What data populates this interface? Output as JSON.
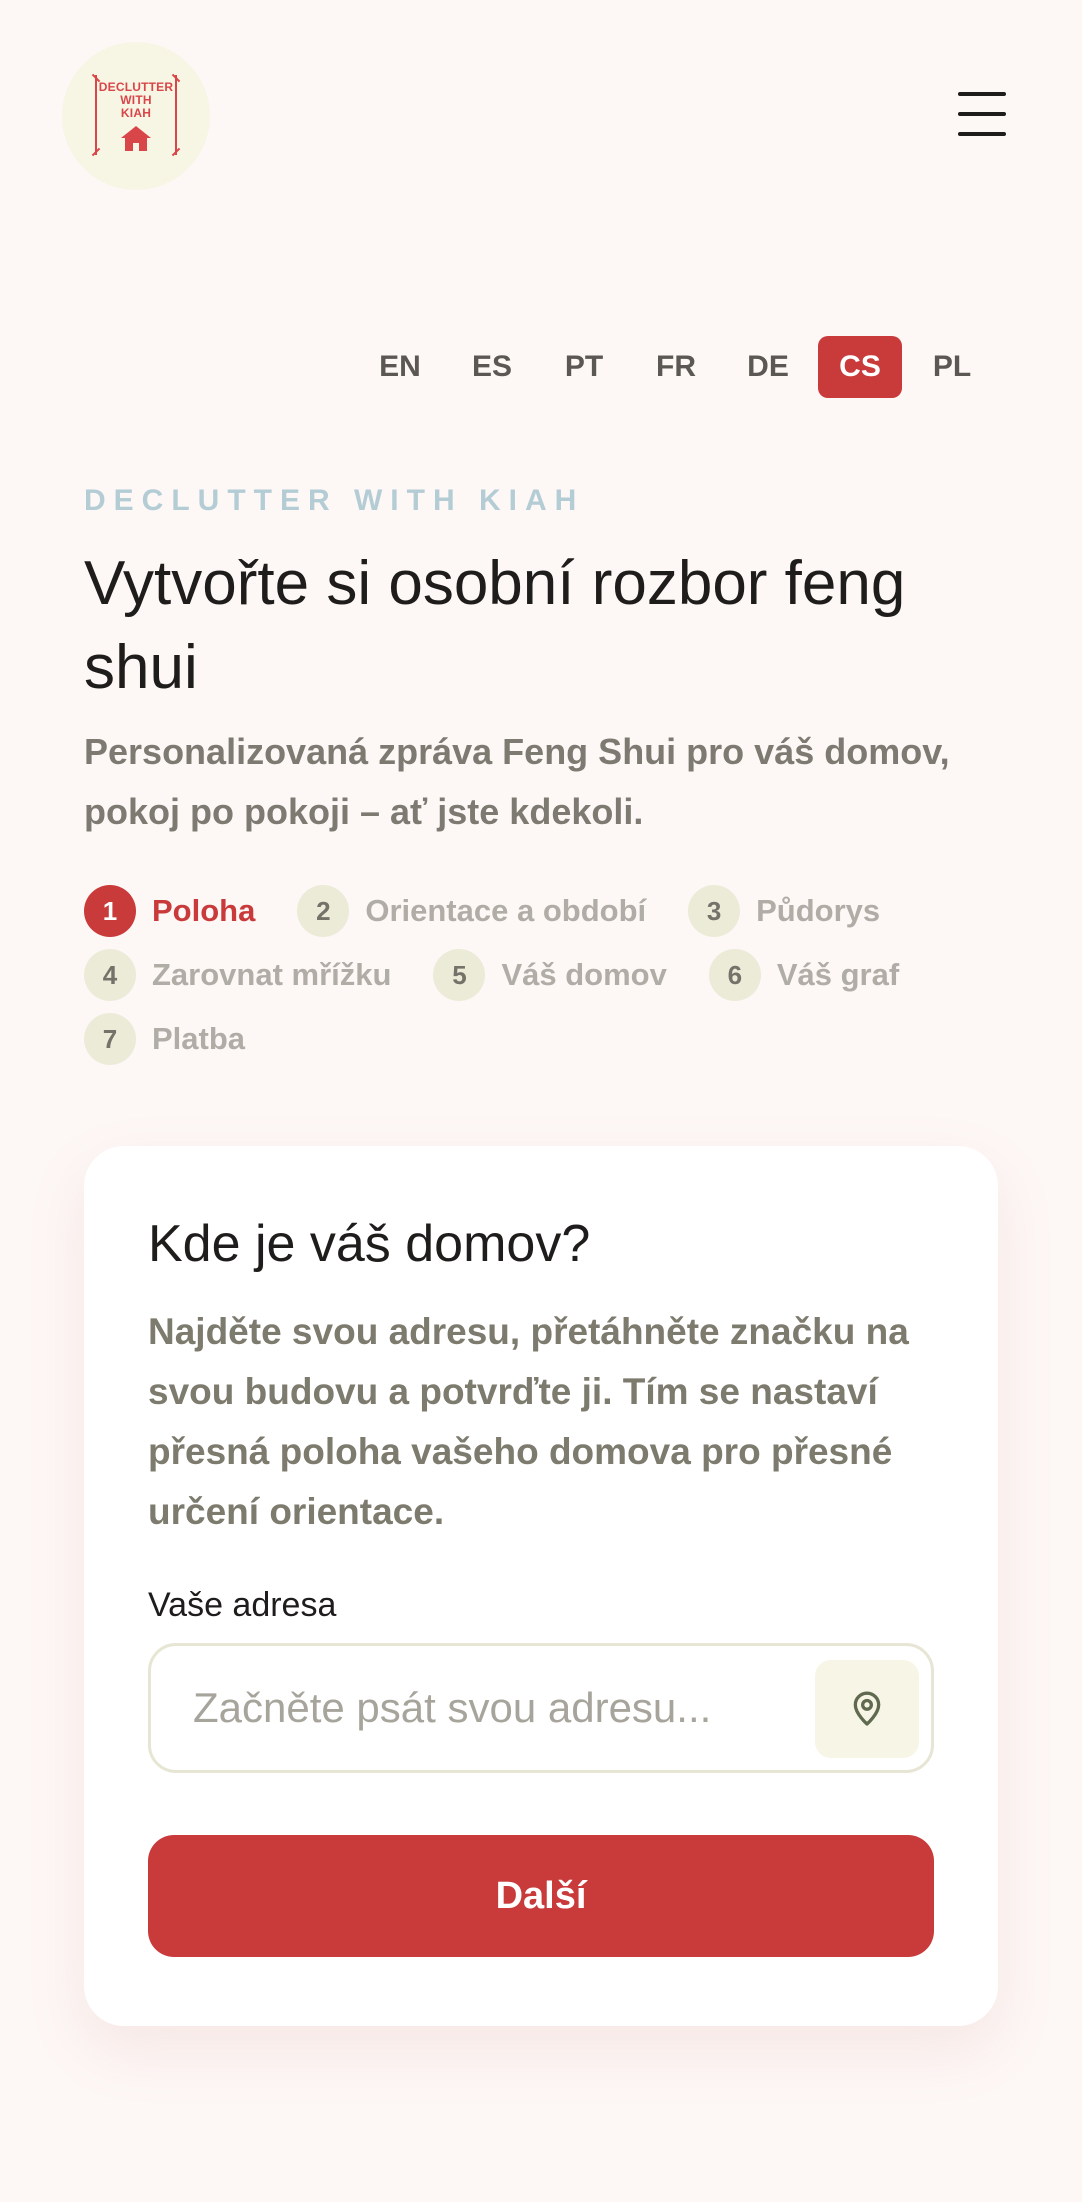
{
  "header": {
    "logo_lines": [
      "DECLUTTER",
      "WITH",
      "KIAH"
    ],
    "menu_icon": "hamburger-menu-icon"
  },
  "languages": [
    {
      "code": "EN",
      "active": false
    },
    {
      "code": "ES",
      "active": false
    },
    {
      "code": "PT",
      "active": false
    },
    {
      "code": "FR",
      "active": false
    },
    {
      "code": "DE",
      "active": false
    },
    {
      "code": "CS",
      "active": true
    },
    {
      "code": "PL",
      "active": false
    }
  ],
  "intro": {
    "eyebrow": "DECLUTTER WITH KIAH",
    "title": "Vytvořte si osobní rozbor feng shui",
    "subtitle": "Personalizovaná zpráva Feng Shui pro váš domov, pokoj po pokoji – ať jste kdekoli."
  },
  "steps": [
    {
      "num": "1",
      "label": "Poloha",
      "active": true
    },
    {
      "num": "2",
      "label": "Orientace a období",
      "active": false
    },
    {
      "num": "3",
      "label": "Půdorys",
      "active": false
    },
    {
      "num": "4",
      "label": "Zarovnat mřížku",
      "active": false
    },
    {
      "num": "5",
      "label": "Váš domov",
      "active": false
    },
    {
      "num": "6",
      "label": "Váš graf",
      "active": false
    },
    {
      "num": "7",
      "label": "Platba",
      "active": false
    }
  ],
  "card": {
    "title": "Kde je váš domov?",
    "description": "Najděte svou adresu, přetáhněte značku na svou budovu a potvrďte ji. Tím se nastaví přesná poloha vašeho domova pro přesné určení orientace.",
    "address_label": "Vaše adresa",
    "address_placeholder": "Začněte psát svou adresu...",
    "address_value": "",
    "location_icon": "map-pin-icon",
    "next_label": "Další"
  },
  "colors": {
    "accent": "#c93a3b",
    "background": "#fdf7f6",
    "eyebrow": "#b4cdd5",
    "step_inactive_bg": "#ecebd8"
  }
}
